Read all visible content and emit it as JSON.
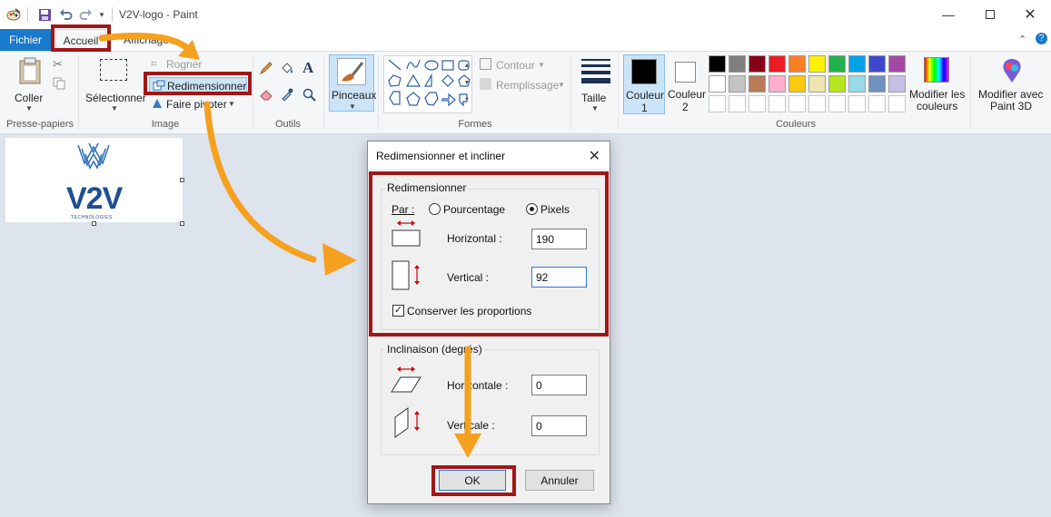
{
  "window": {
    "title": "V2V-logo - Paint",
    "minimize_icon": "minimize-icon",
    "maximize_icon": "maximize-icon",
    "close_icon": "close-icon"
  },
  "menu": {
    "file": "Fichier",
    "home": "Accueil",
    "view": "Affichage"
  },
  "ribbon": {
    "clipboard": {
      "paste": "Coller",
      "group": "Presse-papiers"
    },
    "image": {
      "select": "Sélectionner",
      "crop": "Rogner",
      "resize": "Redimensionner",
      "rotate": "Faire pivoter",
      "group": "Image"
    },
    "tools": {
      "group": "Outils"
    },
    "brushes": {
      "label": "Pinceaux"
    },
    "shapes": {
      "outline": "Contour",
      "fill": "Remplissage",
      "group": "Formes"
    },
    "size": {
      "label": "Taille"
    },
    "colors": {
      "color1_line1": "Couleur",
      "color1_line2": "1",
      "color2_line1": "Couleur",
      "color2_line2": "2",
      "edit_line1": "Modifier les",
      "edit_line2": "couleurs",
      "group": "Couleurs",
      "palette_row1": [
        "#000000",
        "#7f7f7f",
        "#880015",
        "#ed1c24",
        "#ff7f27",
        "#fff200",
        "#22b14c",
        "#00a2e8",
        "#3f48cc",
        "#a349a4"
      ],
      "palette_row2": [
        "#ffffff",
        "#c3c3c3",
        "#b97a57",
        "#ffaec9",
        "#ffc90e",
        "#efe4b0",
        "#b5e61d",
        "#99d9ea",
        "#7092be",
        "#c8bfe7"
      ]
    },
    "paint3d": {
      "line1": "Modifier avec",
      "line2": "Paint 3D"
    }
  },
  "canvas": {
    "logo_text": "V2V",
    "logo_subtext": "TECHNOLOGIES"
  },
  "dialog": {
    "title": "Redimensionner et incliner",
    "resize_group": "Redimensionner",
    "by_label": "Par :",
    "percentage": "Pourcentage",
    "pixels": "Pixels",
    "horizontal_label": "Horizontal :",
    "horizontal_value": "190",
    "vertical_label": "Vertical :",
    "vertical_value": "92",
    "keep_ratio": "Conserver les proportions",
    "skew_group": "Inclinaison (degrés)",
    "skew_horizontal_label": "Horizontale :",
    "skew_horizontal_value": "0",
    "skew_vertical_label": "Verticale :",
    "skew_vertical_value": "0",
    "ok": "OK",
    "cancel": "Annuler"
  },
  "colors": {
    "accent_blue": "#1979ca",
    "annotation_red": "#a31616",
    "annotation_orange": "#f5a01e"
  }
}
